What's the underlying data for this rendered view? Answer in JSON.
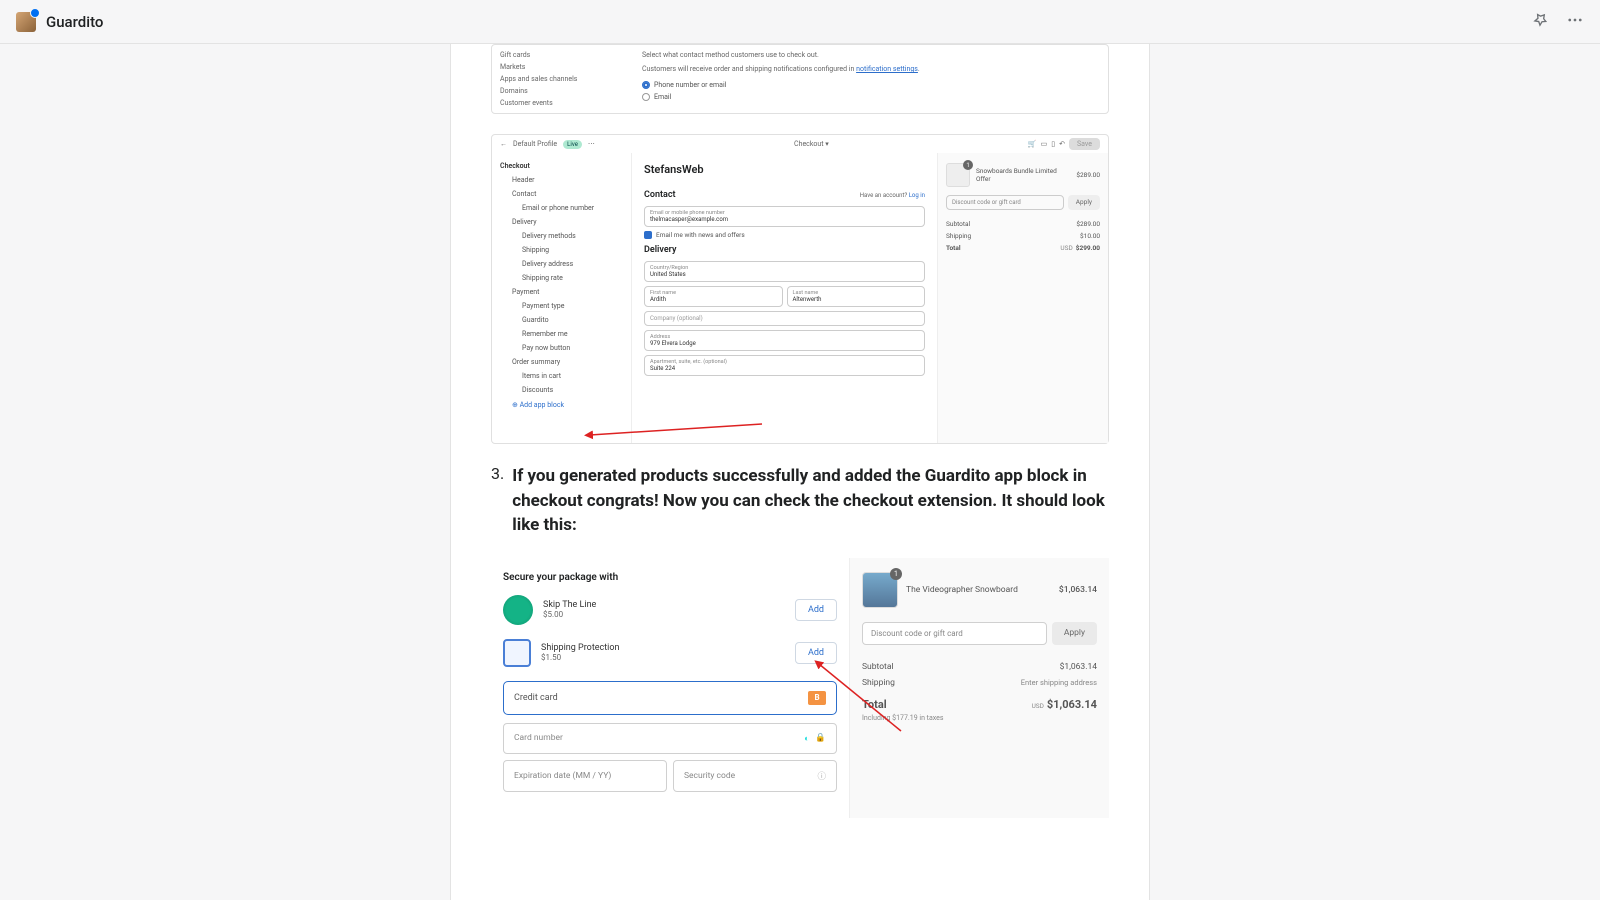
{
  "topbar": {
    "title": "Guardito"
  },
  "shot1": {
    "side": [
      "Gift cards",
      "Markets",
      "Apps and sales channels",
      "Domains",
      "Customer events"
    ],
    "desc1": "Select what contact method customers use to check out.",
    "desc2a": "Customers will receive order and shipping notifications configured in ",
    "desc2_link": "notification settings",
    "opt1": "Phone number or email",
    "opt2": "Email"
  },
  "shot2": {
    "top": {
      "profile": "Default Profile",
      "live": "Live",
      "center": "Checkout",
      "save": "Save"
    },
    "side": {
      "header": "Checkout",
      "groups": [
        {
          "h": "Header"
        },
        {
          "h": "Contact",
          "items": [
            "Email or phone number"
          ]
        },
        {
          "h": "Delivery",
          "items": [
            "Delivery methods",
            "Shipping",
            "Delivery address",
            "Shipping rate"
          ]
        },
        {
          "h": "Payment",
          "items": [
            "Payment type",
            "Guardito",
            "Remember me",
            "Pay now button"
          ]
        },
        {
          "h": "Order summary",
          "items": [
            "Items in cart",
            "Discounts"
          ]
        }
      ],
      "add": "Add app block"
    },
    "form": {
      "store": "StefansWeb",
      "contactH": "Contact",
      "login_pre": "Have an account? ",
      "login": "Log in",
      "emailLbl": "Email or mobile phone number",
      "emailVal": "thelmacasper@example.com",
      "newsOpt": "Email me with news and offers",
      "deliveryH": "Delivery",
      "countryLbl": "Country/Region",
      "countryVal": "United States",
      "fnLbl": "First name",
      "fnVal": "Ardith",
      "lnLbl": "Last name",
      "lnVal": "Altenwerth",
      "companyPh": "Company (optional)",
      "addrLbl": "Address",
      "addrVal": "979 Elvera Lodge",
      "aptLbl": "Apartment, suite, etc. (optional)",
      "aptVal": "Suite 224"
    },
    "summary": {
      "qty": "1",
      "item": "Snowboards Bundle Limited Offer",
      "itemPrice": "$289.00",
      "discPh": "Discount code or gift card",
      "apply": "Apply",
      "sub": "Subtotal",
      "subV": "$289.00",
      "ship": "Shipping",
      "shipV": "$10.00",
      "tot": "Total",
      "usd": "USD",
      "totV": "$299.00"
    }
  },
  "doc": {
    "num": "3.",
    "text": "If you generated products successfully and added the Guardito app block in checkout congrats! Now you can check the checkout extension. It should look like this:"
  },
  "shot3": {
    "left": {
      "secure": "Secure your package with",
      "addons": [
        {
          "name": "Skip The Line",
          "price": "$5.00",
          "btn": "Add"
        },
        {
          "name": "Shipping Protection",
          "price": "$1.50",
          "btn": "Add"
        }
      ],
      "cc": "Credit card",
      "ccBadge": "B",
      "cardNum": "Card number",
      "exp": "Expiration date (MM / YY)",
      "sec": "Security code"
    },
    "right": {
      "qty": "1",
      "item": "The Videographer Snowboard",
      "itemPrice": "$1,063.14",
      "discPh": "Discount code or gift card",
      "apply": "Apply",
      "sub": "Subtotal",
      "subV": "$1,063.14",
      "ship": "Shipping",
      "shipV": "Enter shipping address",
      "tot": "Total",
      "usd": "USD",
      "totV": "$1,063.14",
      "tax": "Including $177.19 in taxes"
    }
  }
}
